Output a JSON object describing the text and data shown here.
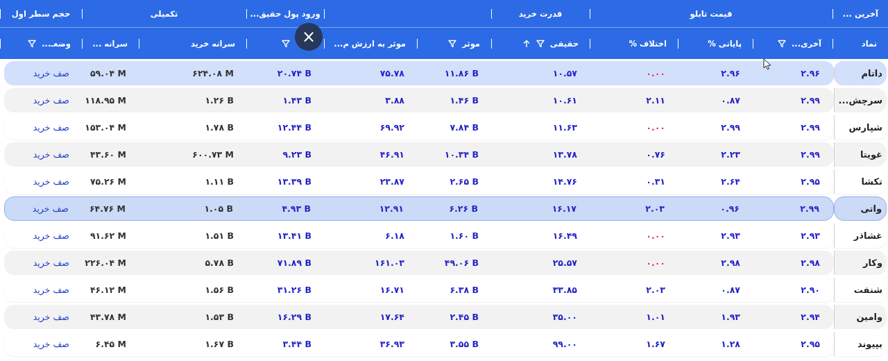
{
  "group_headers": [
    {
      "label": "آخرین ..."
    },
    {
      "label": "قیمت تابلو"
    },
    {
      "label": "قدرت خرید"
    },
    {
      "label": "ورود پول حقیق..."
    },
    {
      "label": "تکمیلی"
    },
    {
      "label": "حجم سطر اول"
    }
  ],
  "columns": [
    {
      "label": "نماد",
      "filter": false,
      "sorted": false
    },
    {
      "label": "آخری...",
      "filter": true,
      "sorted": false
    },
    {
      "label": "پایانی %",
      "filter": false,
      "sorted": false
    },
    {
      "label": "اختلاف %",
      "filter": false,
      "sorted": false
    },
    {
      "label": "حقیقی",
      "filter": true,
      "sorted": true
    },
    {
      "label": "موثر",
      "filter": true,
      "sorted": false
    },
    {
      "label": "موثر به ارزش م...",
      "filter": false,
      "sorted": false
    },
    {
      "filter": true,
      "sorted": false
    },
    {
      "label": "سرانه خرید",
      "filter": false,
      "sorted": false
    },
    {
      "label": "سرانه ...",
      "filter": false,
      "sorted": false
    },
    {
      "label": "وضعـ...",
      "filter": true,
      "sorted": false
    }
  ],
  "close_button": {
    "label": "×"
  },
  "rows": [
    {
      "symbol": "داتام",
      "hovered": true,
      "selected": false,
      "cells": [
        "۲.۹۶",
        "۲.۹۶",
        {
          "text": "۰.۰۰",
          "color": "#e0312f"
        },
        "۱۰.۵۷",
        "۱۱.۸۶ B",
        "۷۵.۷۸",
        "۲۰.۷۴ B",
        "۶۲۴.۰۸ M",
        "۵۹.۰۴ M",
        "صف خرید"
      ]
    },
    {
      "symbol": "سرچش...",
      "hovered": false,
      "selected": false,
      "cells": [
        "۲.۹۹",
        "۰.۸۷",
        {
          "text": "۲.۱۱",
          "color": "#2424c8"
        },
        "۱۰.۶۱",
        "۱.۴۶ B",
        "۳.۸۸",
        "۱.۴۳ B",
        "۱.۲۶ B",
        "۱۱۸.۹۵ M",
        "صف خرید"
      ]
    },
    {
      "symbol": "شپارس",
      "hovered": false,
      "selected": false,
      "cells": [
        "۲.۹۹",
        "۲.۹۹",
        {
          "text": "۰.۰۰",
          "color": "#e0312f"
        },
        "۱۱.۶۳",
        "۷.۸۴ B",
        "۶۹.۹۲",
        "۱۲.۴۴ B",
        "۱.۷۸ B",
        "۱۵۳.۰۴ M",
        "صف خرید"
      ]
    },
    {
      "symbol": "غویتا",
      "hovered": false,
      "selected": false,
      "cells": [
        "۲.۹۹",
        "۲.۲۳",
        {
          "text": "۰.۷۶",
          "color": "#2424c8"
        },
        "۱۳.۷۸",
        "۱۰.۳۴ B",
        "۴۶.۹۱",
        "۹.۲۳ B",
        "۶۰۰.۷۳ M",
        "۴۳.۶۰ M",
        "صف خرید"
      ]
    },
    {
      "symbol": "تکشا",
      "hovered": false,
      "selected": false,
      "cells": [
        "۲.۹۵",
        "۲.۶۴",
        {
          "text": "۰.۳۱",
          "color": "#2424c8"
        },
        "۱۴.۷۶",
        "۲.۶۵ B",
        "۲۳.۸۷",
        "۱۳.۳۹ B",
        "۱.۱۱ B",
        "۷۵.۲۶ M",
        "صف خرید"
      ]
    },
    {
      "symbol": "واتی",
      "hovered": false,
      "selected": true,
      "cells": [
        "۲.۹۹",
        "۰.۹۶",
        {
          "text": "۲.۰۳",
          "color": "#2424c8"
        },
        "۱۶.۱۷",
        "۶.۲۶ B",
        "۱۲.۹۱",
        "۴.۹۳ B",
        "۱.۰۵ B",
        "۶۴.۷۶ M",
        "صف خرید"
      ]
    },
    {
      "symbol": "غشاذر",
      "hovered": false,
      "selected": false,
      "cells": [
        "۲.۹۳",
        "۲.۹۳",
        {
          "text": "۰.۰۰",
          "color": "#e0312f"
        },
        "۱۶.۴۹",
        "۱.۶۰ B",
        "۶.۱۸",
        "۱۳.۴۱ B",
        "۱.۵۱ B",
        "۹۱.۶۲ M",
        "صف خرید"
      ]
    },
    {
      "symbol": "وکار",
      "hovered": false,
      "selected": false,
      "cells": [
        "۲.۹۸",
        "۲.۹۸",
        {
          "text": "۰.۰۰",
          "color": "#e0312f"
        },
        "۲۵.۵۷",
        "۴۹.۰۶ B",
        "۱۶۱.۰۳",
        "۷۱.۸۹ B",
        "۵.۷۸ B",
        "۲۲۶.۰۴ M",
        "صف خرید"
      ]
    },
    {
      "symbol": "شنفت",
      "hovered": false,
      "selected": false,
      "cells": [
        "۲.۹۰",
        "۰.۸۷",
        {
          "text": "۲.۰۳",
          "color": "#2424c8"
        },
        "۳۳.۸۵",
        "۶.۳۸ B",
        "۱۶.۷۱",
        "۳۱.۲۶ B",
        "۱.۵۶ B",
        "۴۶.۱۲ M",
        "صف خرید"
      ]
    },
    {
      "symbol": "وامین",
      "hovered": false,
      "selected": false,
      "cells": [
        "۲.۹۴",
        "۱.۹۳",
        {
          "text": "۱.۰۱",
          "color": "#2424c8"
        },
        "۳۵.۰۰",
        "۲.۴۵ B",
        "۱۷.۶۴",
        "۱۶.۲۹ B",
        "۱.۵۳ B",
        "۴۳.۷۸ M",
        "صف خرید"
      ]
    },
    {
      "symbol": "بپیوند",
      "hovered": false,
      "selected": false,
      "cells": [
        "۲.۹۵",
        "۱.۲۸",
        {
          "text": "۱.۶۷",
          "color": "#2424c8"
        },
        "۹۹.۰۰",
        "۳.۵۵ B",
        "۳۶.۹۳",
        "۳.۴۴ B",
        "۱.۶۷ B",
        "۶.۴۵ M",
        "صف خرید"
      ]
    }
  ]
}
